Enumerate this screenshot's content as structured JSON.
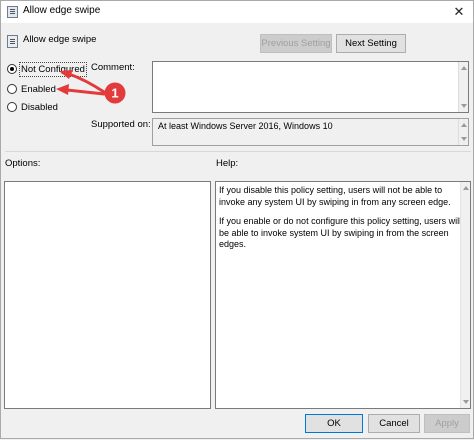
{
  "window": {
    "title": "Allow edge swipe",
    "close_glyph": "✕"
  },
  "header": {
    "policy_name": "Allow edge swipe",
    "previous_label": "Previous Setting",
    "next_label": "Next Setting"
  },
  "state": {
    "options": [
      {
        "label": "Not Configured",
        "checked": true
      },
      {
        "label": "Enabled",
        "checked": false
      },
      {
        "label": "Disabled",
        "checked": false
      }
    ]
  },
  "comment": {
    "label": "Comment:",
    "value": ""
  },
  "supported": {
    "label": "Supported on:",
    "value": "At least Windows Server 2016, Windows 10"
  },
  "options_pane": {
    "label": "Options:"
  },
  "help_pane": {
    "label": "Help:",
    "paragraphs": [
      "If you disable this policy setting, users will not be able to invoke any system UI by swiping in from any screen edge.",
      "If you enable or do not configure this policy setting, users will be able to invoke system UI by swiping in from the screen edges."
    ]
  },
  "footer": {
    "ok_label": "OK",
    "cancel_label": "Cancel",
    "apply_label": "Apply"
  },
  "annotation": {
    "badge_text": "1",
    "color": "#e33b3b"
  },
  "icons": {
    "app": "policy-icon",
    "close": "close-icon"
  }
}
